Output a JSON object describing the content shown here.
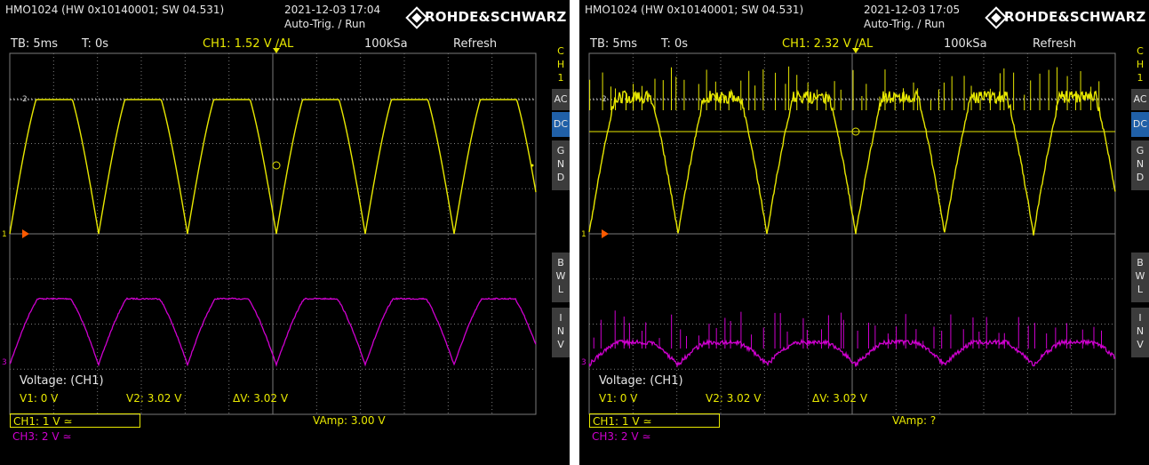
{
  "panels": [
    {
      "header": {
        "device": "HMO1024 (HW 0x10140001; SW 04.531)",
        "datetime": "2021-12-03 17:04",
        "trigger_mode": "Auto-Trig. / Run",
        "brand": "ROHDE&SCHWARZ"
      },
      "status": {
        "timebase": "TB: 5ms",
        "time_offset": "T: 0s",
        "trigger": "CH1: 1.52 V ∕AL",
        "sample_rate": "100kSa",
        "acq_mode": "Refresh"
      },
      "side_menu": {
        "channel_tab": "C\nH\n1",
        "ac": "AC",
        "dc": "DC",
        "gnd": "G\nN\nD",
        "bwl": "B\nW\nL",
        "inv": "I\nN\nV"
      },
      "markers": {
        "ch1": "1",
        "ch3": "3",
        "ref": "2"
      },
      "measurement": {
        "title": "Voltage: (CH1)",
        "v1": "V1: 0 V",
        "v2": "V2: 3.02 V",
        "dv": "ΔV: 3.02 V",
        "vamp": "VAmp: 3.00 V"
      },
      "channels": {
        "ch1": "CH1: 1 V ≃",
        "ch3": "CH3: 2 V ≃"
      },
      "colors": {
        "ch1": "#e8e800",
        "ch3": "#d000d0",
        "grid": "#7a7a7a"
      },
      "noisy": false
    },
    {
      "header": {
        "device": "HMO1024 (HW 0x10140001; SW 04.531)",
        "datetime": "2021-12-03 17:05",
        "trigger_mode": "Auto-Trig. / Run",
        "brand": "ROHDE&SCHWARZ"
      },
      "status": {
        "timebase": "TB: 5ms",
        "time_offset": "T: 0s",
        "trigger": "CH1: 2.32 V ∕AL",
        "sample_rate": "100kSa",
        "acq_mode": "Refresh"
      },
      "side_menu": {
        "channel_tab": "C\nH\n1",
        "ac": "AC",
        "dc": "DC",
        "gnd": "G\nN\nD",
        "bwl": "B\nW\nL",
        "inv": "I\nN\nV"
      },
      "markers": {
        "ch1": "1",
        "ch3": "3",
        "ref": "2"
      },
      "measurement": {
        "title": "Voltage: (CH1)",
        "v1": "V1: 0 V",
        "v2": "V2: 3.02 V",
        "dv": "ΔV: 3.02 V",
        "vamp": "VAmp: ?"
      },
      "channels": {
        "ch1": "CH1: 1 V ≃",
        "ch3": "CH3: 2 V ≃"
      },
      "colors": {
        "ch1": "#e8e800",
        "ch3": "#d000d0",
        "grid": "#7a7a7a"
      },
      "noisy": true
    }
  ]
}
